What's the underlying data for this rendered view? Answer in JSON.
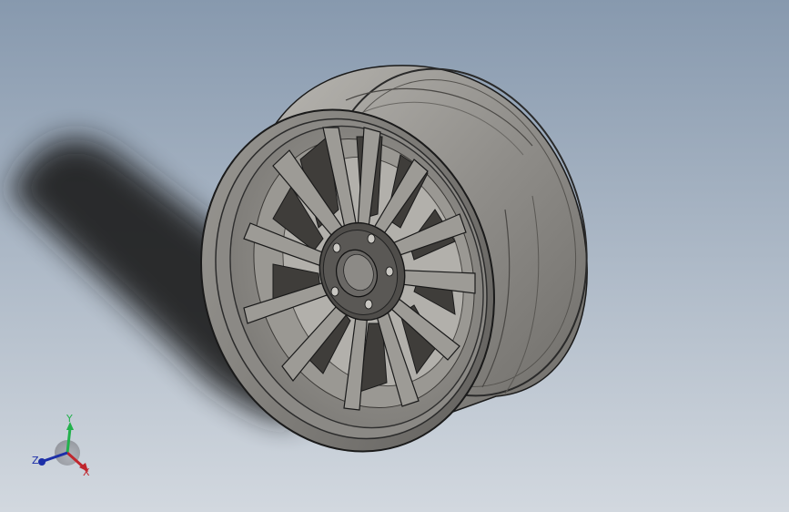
{
  "viewport": {
    "background_top": "#8799ae",
    "background_bottom": "#d2d8df",
    "model": {
      "name": "wheel-rim",
      "spoke_count": 10,
      "lug_hole_count": 5,
      "colors": {
        "rim_fill": "#8c8a86",
        "rim_dark": "#5e5c59",
        "rim_light": "#b3b1ac",
        "outline": "#1a1a1a",
        "shadow": "#1e1e1e"
      }
    }
  },
  "triad": {
    "y_label": "Y",
    "x_label": "X",
    "z_label": "Z",
    "y_color": "#22b14c",
    "x_color": "#c0262d",
    "z_color": "#1c2fa8"
  }
}
